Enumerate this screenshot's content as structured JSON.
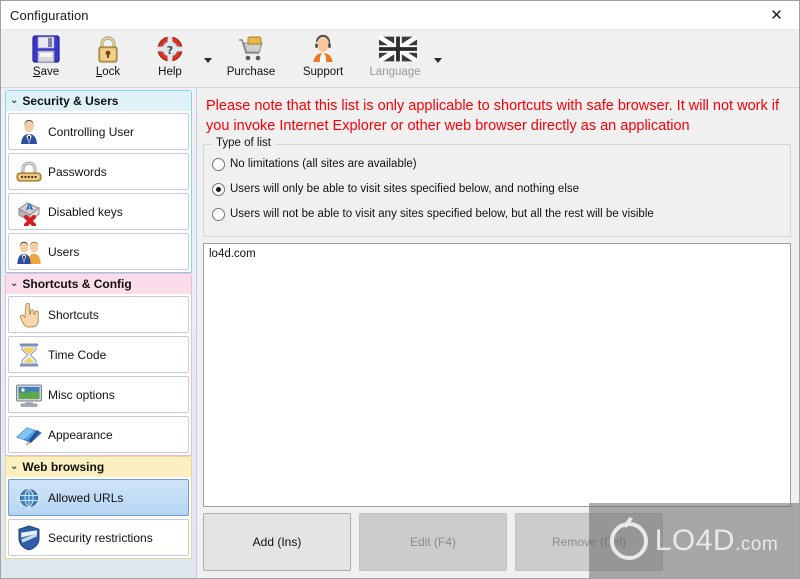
{
  "window": {
    "title": "Configuration",
    "close_label": "✕"
  },
  "toolbar": {
    "items": [
      {
        "label": "Save",
        "icon": "floppy-disk-icon",
        "underline": "S",
        "disabled": false
      },
      {
        "label": "Lock",
        "icon": "padlock-icon",
        "underline": "L",
        "disabled": false
      },
      {
        "label": "Help",
        "icon": "lifebuoy-question-icon",
        "underline": "",
        "disabled": false
      },
      {
        "label": "Purchase",
        "icon": "shopping-cart-icon",
        "underline": "",
        "disabled": false
      },
      {
        "label": "Support",
        "icon": "headset-person-icon",
        "underline": "",
        "disabled": false
      },
      {
        "label": "Language",
        "icon": "uk-flag-icon",
        "underline": "",
        "disabled": true
      }
    ]
  },
  "sidebar": {
    "groups": [
      {
        "title": "Security & Users",
        "theme": "sec",
        "items": [
          {
            "label": "Controlling User",
            "icon": "user-tie-icon",
            "selected": false
          },
          {
            "label": "Passwords",
            "icon": "padlock-dots-icon",
            "selected": false
          },
          {
            "label": "Disabled keys",
            "icon": "key-cross-icon",
            "selected": false
          },
          {
            "label": "Users",
            "icon": "two-users-icon",
            "selected": false
          }
        ]
      },
      {
        "title": "Shortcuts & Config",
        "theme": "short",
        "items": [
          {
            "label": "Shortcuts",
            "icon": "pointing-hand-icon",
            "selected": false
          },
          {
            "label": "Time Code",
            "icon": "hourglass-icon",
            "selected": false
          },
          {
            "label": "Misc options",
            "icon": "monitor-icon",
            "selected": false
          },
          {
            "label": "Appearance",
            "icon": "blue-book-pen-icon",
            "selected": false
          }
        ]
      },
      {
        "title": "Web browsing",
        "theme": "web",
        "items": [
          {
            "label": "Allowed URLs",
            "icon": "globe-icon",
            "selected": true
          },
          {
            "label": "Security restrictions",
            "icon": "shield-icon",
            "selected": false
          }
        ]
      }
    ]
  },
  "main": {
    "notice": "Please note that this list is only applicable to shortcuts with safe browser. It will not work if you invoke Internet Explorer or other web browser directly as an application",
    "notice_color": "#fb0007",
    "groupbox_title": "Type of list",
    "radios": [
      {
        "label": "No limitations (all sites are available)",
        "checked": false
      },
      {
        "label": "Users will only be able to visit sites specified below, and nothing else",
        "checked": true
      },
      {
        "label": "Users will not be able to visit any sites specified below, but all the rest will be visible",
        "checked": false
      }
    ],
    "list_items": [
      "lo4d.com"
    ],
    "buttons": [
      {
        "label": "Add (Ins)",
        "disabled": false
      },
      {
        "label": "Edit (F4)",
        "disabled": true
      },
      {
        "label": "Remove (Del)",
        "disabled": true
      }
    ]
  },
  "watermark": {
    "name": "LO4D",
    "suffix": ".com"
  }
}
